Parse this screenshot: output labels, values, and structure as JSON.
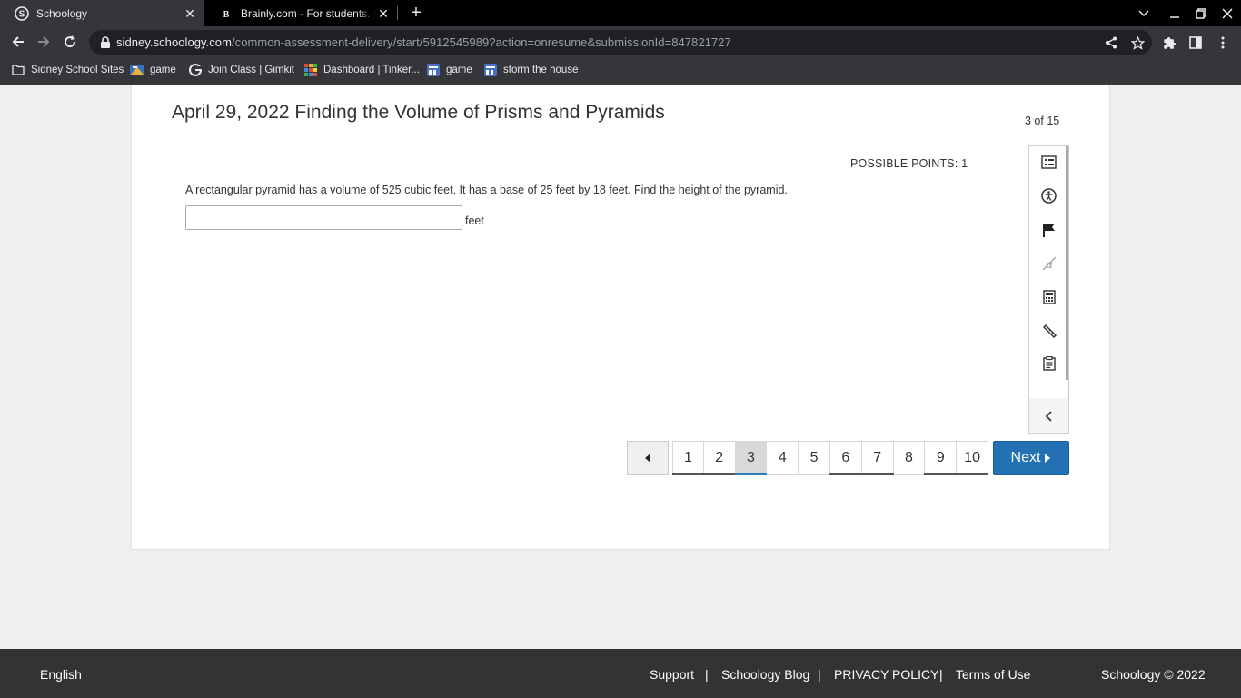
{
  "browser": {
    "tabs": [
      {
        "title": "Schoology",
        "favicon": "schoology-icon",
        "active": true
      },
      {
        "title": "Brainly.com - For students. By students.",
        "favicon": "brainly-icon",
        "active": false
      }
    ],
    "url_host": "sidney.schoology.com",
    "url_path": "/common-assessment-delivery/start/5912545989?action=onresume&submissionId=847821727",
    "bookmarks": [
      {
        "label": "Sidney School Sites",
        "icon": "folder-icon"
      },
      {
        "label": "game",
        "icon": "game-icon"
      },
      {
        "label": "Join Class | Gimkit",
        "icon": "gimkit-icon"
      },
      {
        "label": "Dashboard | Tinker...",
        "icon": "tinkercad-icon"
      },
      {
        "label": "game",
        "icon": "page-icon"
      },
      {
        "label": "storm the house",
        "icon": "page-icon"
      }
    ]
  },
  "assessment": {
    "title": "April 29, 2022 Finding the Volume of Prisms and Pyramids",
    "question_counter": "3 of 15",
    "possible_points": "POSSIBLE POINTS: 1",
    "question_text": "A rectangular pyramid has a volume of 525 cubic feet. It has a base of 25 feet by 18 feet. Find the height of the pyramid.",
    "answer_value": "",
    "answer_unit": "feet",
    "tools": [
      "question-list-icon",
      "accessibility-icon",
      "flag-icon",
      "strikethrough-icon",
      "calculator-icon",
      "ruler-icon",
      "notepad-icon",
      "collapse-chevron-icon"
    ],
    "pagination": {
      "pages": [
        {
          "n": "1",
          "state": "answered"
        },
        {
          "n": "2",
          "state": "answered"
        },
        {
          "n": "3",
          "state": "current"
        },
        {
          "n": "4",
          "state": "none"
        },
        {
          "n": "5",
          "state": "none"
        },
        {
          "n": "6",
          "state": "answered"
        },
        {
          "n": "7",
          "state": "answered"
        },
        {
          "n": "8",
          "state": "none"
        },
        {
          "n": "9",
          "state": "answered"
        },
        {
          "n": "10",
          "state": "answered"
        }
      ],
      "next_label": "Next"
    }
  },
  "footer": {
    "language": "English",
    "links": [
      "Support",
      "|",
      "Schoology Blog",
      "|",
      "PRIVACY POLICY",
      "|",
      "Terms of Use"
    ],
    "copyright": "Schoology © 2022"
  },
  "colors": {
    "accent": "#2271b3",
    "footer_bg": "#333333",
    "chrome_bg": "#35363a"
  }
}
